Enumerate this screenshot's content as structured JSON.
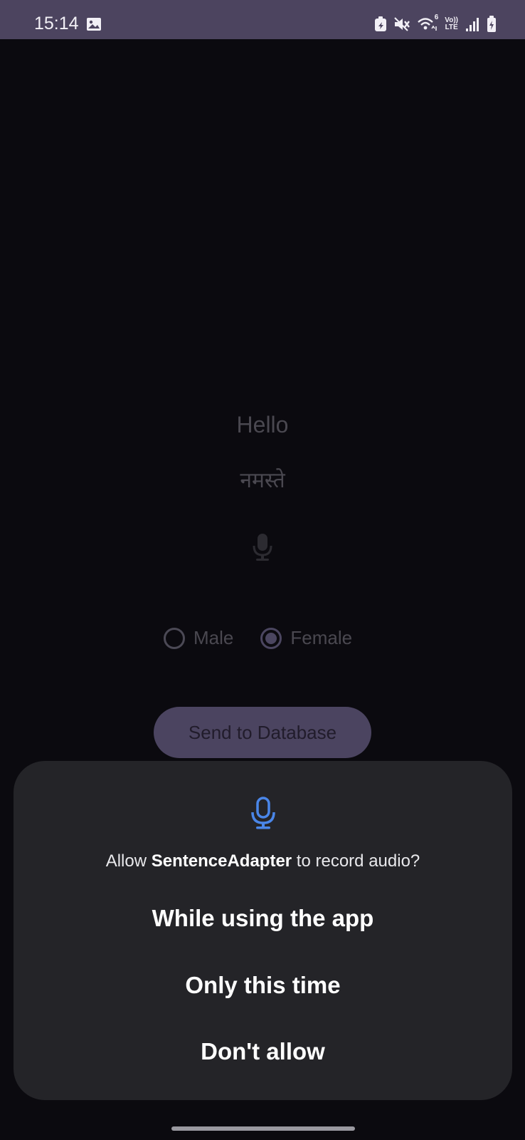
{
  "status_bar": {
    "time": "15:14",
    "network_label_top": "Vo))",
    "network_label_bottom": "LTE",
    "wifi_badge": "6"
  },
  "app": {
    "english_word": "Hello",
    "hindi_word": "नमस्ते",
    "gender": {
      "options": [
        "Male",
        "Female"
      ],
      "selected": "Female"
    },
    "send_button": "Send to Database"
  },
  "permission_dialog": {
    "message_prefix": "Allow ",
    "app_name": "SentenceAdapter",
    "message_suffix": " to record audio?",
    "options": [
      "While using the app",
      "Only this time",
      "Don't allow"
    ],
    "icon": "mic-icon",
    "accent_color": "#4a86e8"
  }
}
